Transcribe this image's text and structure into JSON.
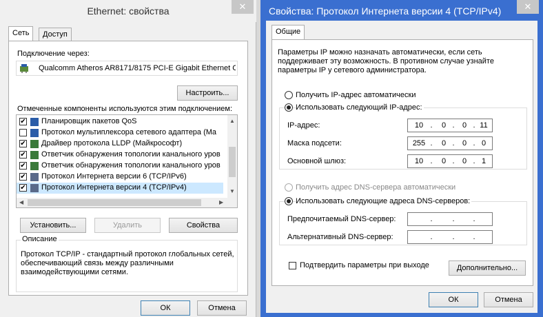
{
  "win1": {
    "title": "Ethernet: свойства",
    "close": "✕",
    "tabs": [
      "Сеть",
      "Доступ"
    ],
    "connect_label": "Подключение через:",
    "adapter_name": "Qualcomm Atheros AR8171/8175 PCI-E Gigabit Ethernet C",
    "configure_btn": "Настроить...",
    "components_label": "Отмеченные компоненты используются этим подключением:",
    "components": [
      {
        "label": "Планировщик пакетов QoS",
        "checked": true
      },
      {
        "label": "Протокол мультиплексора сетевого адаптера (Ma",
        "checked": false
      },
      {
        "label": "Драйвер протокола LLDP (Майкрософт)",
        "checked": true
      },
      {
        "label": "Ответчик обнаружения топологии канального уров",
        "checked": true
      },
      {
        "label": "Ответчик обнаружения топологии канального уров",
        "checked": true
      },
      {
        "label": "Протокол Интернета версии 6 (TCP/IPv6)",
        "checked": true
      },
      {
        "label": "Протокол Интернета версии 4 (TCP/IPv4)",
        "checked": true
      }
    ],
    "install_btn": "Установить...",
    "remove_btn": "Удалить",
    "properties_btn": "Свойства",
    "description_title": "Описание",
    "description_text": "Протокол TCP/IP - стандартный протокол глобальных сетей, обеспечивающий связь между различными взаимодействующими сетями.",
    "ok_btn": "ОК",
    "cancel_btn": "Отмена"
  },
  "win2": {
    "title": "Свойства: Протокол Интернета версии 4 (TCP/IPv4)",
    "close": "✕",
    "tab": "Общие",
    "intro": "Параметры IP можно назначать автоматически, если сеть поддерживает эту возможность. В противном случае узнайте параметры IP у сетевого администратора.",
    "auto_ip": "Получить IP-адрес автоматически",
    "manual_ip": "Использовать следующий IP-адрес:",
    "ip_label": "IP-адрес:",
    "ip_value": [
      "10",
      "0",
      "0",
      "11"
    ],
    "mask_label": "Маска подсети:",
    "mask_value": [
      "255",
      "0",
      "0",
      "0"
    ],
    "gateway_label": "Основной шлюз:",
    "gateway_value": [
      "10",
      "0",
      "0",
      "1"
    ],
    "auto_dns": "Получить адрес DNS-сервера автоматически",
    "manual_dns": "Использовать следующие адреса DNS-серверов:",
    "pref_dns_label": "Предпочитаемый DNS-сервер:",
    "alt_dns_label": "Альтернативный DNS-сервер:",
    "validate_label": "Подтвердить параметры при выходе",
    "advanced_btn": "Дополнительно...",
    "ok_btn": "ОК",
    "cancel_btn": "Отмена"
  },
  "colors": {
    "title_bar_active": "#3a6fd0",
    "selection": "#cce8ff"
  }
}
